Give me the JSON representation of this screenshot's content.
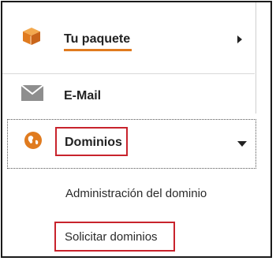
{
  "menu": {
    "package": {
      "label": "Tu paquete",
      "icon": "package-box-icon",
      "accent": "#e07b1f"
    },
    "email": {
      "label": "E-Mail",
      "icon": "envelope-icon"
    },
    "domains": {
      "label": "Dominios",
      "icon": "globe-icon",
      "expanded": true,
      "submenu": [
        {
          "label": "Administración del dominio"
        },
        {
          "label": "Solicitar dominios"
        }
      ]
    }
  },
  "colors": {
    "accent_orange": "#e07b1f",
    "highlight_red": "#c8232c",
    "icon_gray": "#8e8e8e"
  }
}
